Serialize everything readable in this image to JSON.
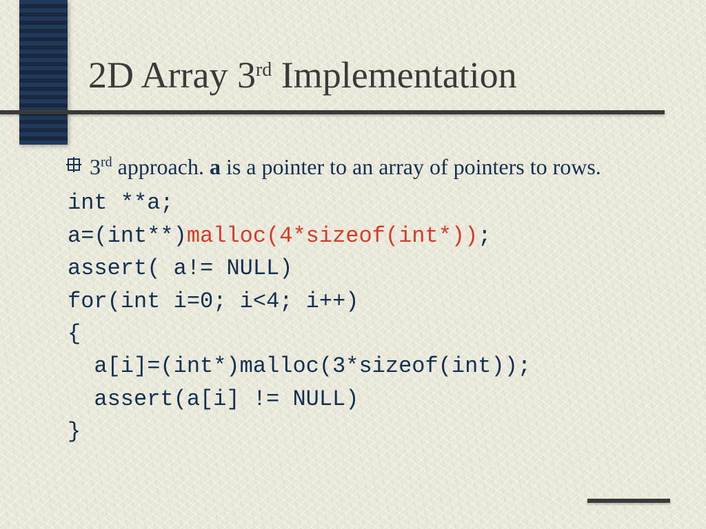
{
  "title": {
    "pre": "2D Array 3",
    "sup": "rd",
    "post": " Implementation"
  },
  "bullet": {
    "num": "3",
    "sup": "rd",
    "afterSup": " approach. ",
    "var": "a",
    "rest": " is a pointer to an array of pointers to rows."
  },
  "code": {
    "l1": "int **a;",
    "l2a": "a=(int**)",
    "l2b": "malloc(4*sizeof(int*))",
    "l2c": ";",
    "l3": "assert( a!= NULL)",
    "l4": "for(int i=0; i<4; i++)",
    "l5": "{",
    "l6": "a[i]=(int*)malloc(3*sizeof(int));",
    "l7": "assert(a[i] != NULL)",
    "l8": "}"
  }
}
